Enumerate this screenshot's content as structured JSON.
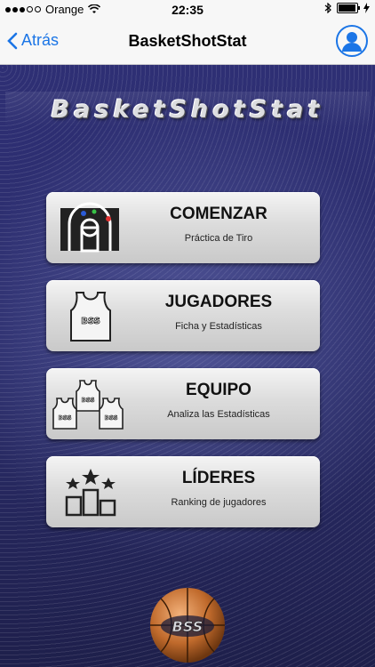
{
  "status_bar": {
    "carrier": "Orange",
    "time": "22:35"
  },
  "nav": {
    "back_label": "Atrás",
    "title": "BasketShotStat"
  },
  "logo": {
    "text": "BasketShotStat"
  },
  "menu": [
    {
      "title": "COMENZAR",
      "subtitle": "Práctica de Tiro",
      "icon": "court-icon"
    },
    {
      "title": "JUGADORES",
      "subtitle": "Ficha y Estadísticas",
      "icon": "jersey-icon"
    },
    {
      "title": "EQUIPO",
      "subtitle": "Analiza las Estadísticas",
      "icon": "team-jerseys-icon"
    },
    {
      "title": "LÍDERES",
      "subtitle": "Ranking de jugadores",
      "icon": "podium-stars-icon"
    }
  ],
  "jersey_badge": "BSS",
  "bottom_logo_text": "BSS",
  "colors": {
    "accent": "#1b75e6",
    "background": "#2b2d6b"
  }
}
